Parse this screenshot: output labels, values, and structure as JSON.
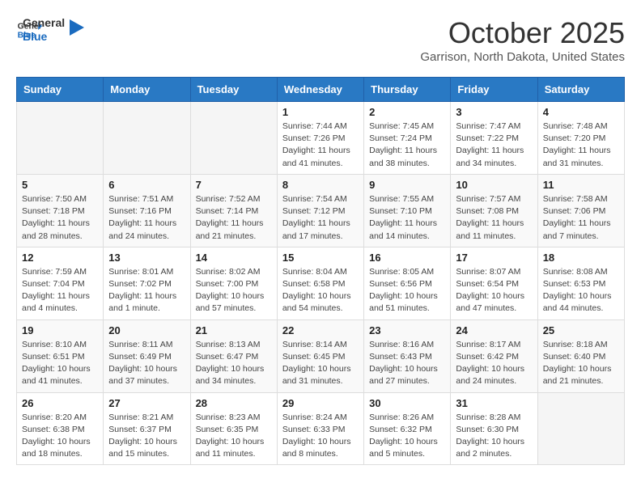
{
  "header": {
    "logo_general": "General",
    "logo_blue": "Blue",
    "month_title": "October 2025",
    "subtitle": "Garrison, North Dakota, United States"
  },
  "days_of_week": [
    "Sunday",
    "Monday",
    "Tuesday",
    "Wednesday",
    "Thursday",
    "Friday",
    "Saturday"
  ],
  "weeks": [
    [
      {
        "day": "",
        "info": ""
      },
      {
        "day": "",
        "info": ""
      },
      {
        "day": "",
        "info": ""
      },
      {
        "day": "1",
        "info": "Sunrise: 7:44 AM\nSunset: 7:26 PM\nDaylight: 11 hours and 41 minutes."
      },
      {
        "day": "2",
        "info": "Sunrise: 7:45 AM\nSunset: 7:24 PM\nDaylight: 11 hours and 38 minutes."
      },
      {
        "day": "3",
        "info": "Sunrise: 7:47 AM\nSunset: 7:22 PM\nDaylight: 11 hours and 34 minutes."
      },
      {
        "day": "4",
        "info": "Sunrise: 7:48 AM\nSunset: 7:20 PM\nDaylight: 11 hours and 31 minutes."
      }
    ],
    [
      {
        "day": "5",
        "info": "Sunrise: 7:50 AM\nSunset: 7:18 PM\nDaylight: 11 hours and 28 minutes."
      },
      {
        "day": "6",
        "info": "Sunrise: 7:51 AM\nSunset: 7:16 PM\nDaylight: 11 hours and 24 minutes."
      },
      {
        "day": "7",
        "info": "Sunrise: 7:52 AM\nSunset: 7:14 PM\nDaylight: 11 hours and 21 minutes."
      },
      {
        "day": "8",
        "info": "Sunrise: 7:54 AM\nSunset: 7:12 PM\nDaylight: 11 hours and 17 minutes."
      },
      {
        "day": "9",
        "info": "Sunrise: 7:55 AM\nSunset: 7:10 PM\nDaylight: 11 hours and 14 minutes."
      },
      {
        "day": "10",
        "info": "Sunrise: 7:57 AM\nSunset: 7:08 PM\nDaylight: 11 hours and 11 minutes."
      },
      {
        "day": "11",
        "info": "Sunrise: 7:58 AM\nSunset: 7:06 PM\nDaylight: 11 hours and 7 minutes."
      }
    ],
    [
      {
        "day": "12",
        "info": "Sunrise: 7:59 AM\nSunset: 7:04 PM\nDaylight: 11 hours and 4 minutes."
      },
      {
        "day": "13",
        "info": "Sunrise: 8:01 AM\nSunset: 7:02 PM\nDaylight: 11 hours and 1 minute."
      },
      {
        "day": "14",
        "info": "Sunrise: 8:02 AM\nSunset: 7:00 PM\nDaylight: 10 hours and 57 minutes."
      },
      {
        "day": "15",
        "info": "Sunrise: 8:04 AM\nSunset: 6:58 PM\nDaylight: 10 hours and 54 minutes."
      },
      {
        "day": "16",
        "info": "Sunrise: 8:05 AM\nSunset: 6:56 PM\nDaylight: 10 hours and 51 minutes."
      },
      {
        "day": "17",
        "info": "Sunrise: 8:07 AM\nSunset: 6:54 PM\nDaylight: 10 hours and 47 minutes."
      },
      {
        "day": "18",
        "info": "Sunrise: 8:08 AM\nSunset: 6:53 PM\nDaylight: 10 hours and 44 minutes."
      }
    ],
    [
      {
        "day": "19",
        "info": "Sunrise: 8:10 AM\nSunset: 6:51 PM\nDaylight: 10 hours and 41 minutes."
      },
      {
        "day": "20",
        "info": "Sunrise: 8:11 AM\nSunset: 6:49 PM\nDaylight: 10 hours and 37 minutes."
      },
      {
        "day": "21",
        "info": "Sunrise: 8:13 AM\nSunset: 6:47 PM\nDaylight: 10 hours and 34 minutes."
      },
      {
        "day": "22",
        "info": "Sunrise: 8:14 AM\nSunset: 6:45 PM\nDaylight: 10 hours and 31 minutes."
      },
      {
        "day": "23",
        "info": "Sunrise: 8:16 AM\nSunset: 6:43 PM\nDaylight: 10 hours and 27 minutes."
      },
      {
        "day": "24",
        "info": "Sunrise: 8:17 AM\nSunset: 6:42 PM\nDaylight: 10 hours and 24 minutes."
      },
      {
        "day": "25",
        "info": "Sunrise: 8:18 AM\nSunset: 6:40 PM\nDaylight: 10 hours and 21 minutes."
      }
    ],
    [
      {
        "day": "26",
        "info": "Sunrise: 8:20 AM\nSunset: 6:38 PM\nDaylight: 10 hours and 18 minutes."
      },
      {
        "day": "27",
        "info": "Sunrise: 8:21 AM\nSunset: 6:37 PM\nDaylight: 10 hours and 15 minutes."
      },
      {
        "day": "28",
        "info": "Sunrise: 8:23 AM\nSunset: 6:35 PM\nDaylight: 10 hours and 11 minutes."
      },
      {
        "day": "29",
        "info": "Sunrise: 8:24 AM\nSunset: 6:33 PM\nDaylight: 10 hours and 8 minutes."
      },
      {
        "day": "30",
        "info": "Sunrise: 8:26 AM\nSunset: 6:32 PM\nDaylight: 10 hours and 5 minutes."
      },
      {
        "day": "31",
        "info": "Sunrise: 8:28 AM\nSunset: 6:30 PM\nDaylight: 10 hours and 2 minutes."
      },
      {
        "day": "",
        "info": ""
      }
    ]
  ]
}
